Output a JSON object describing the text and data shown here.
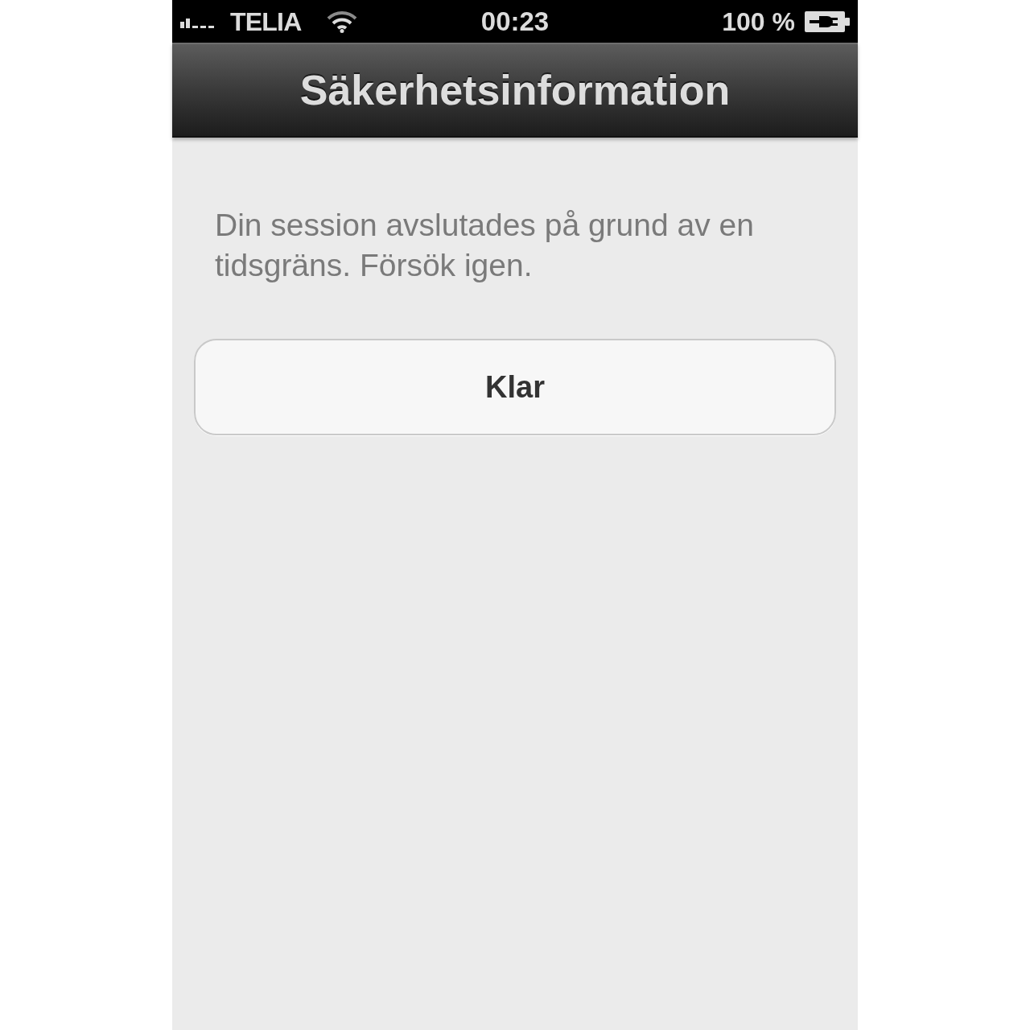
{
  "status_bar": {
    "carrier": "TELIA",
    "time": "00:23",
    "battery": "100 %"
  },
  "nav_bar": {
    "title": "Säkerhetsinformation"
  },
  "message": "Din session avslutades på grund av en tidsgräns. Försök igen.",
  "buttons": [
    {
      "label": "Klar"
    }
  ]
}
